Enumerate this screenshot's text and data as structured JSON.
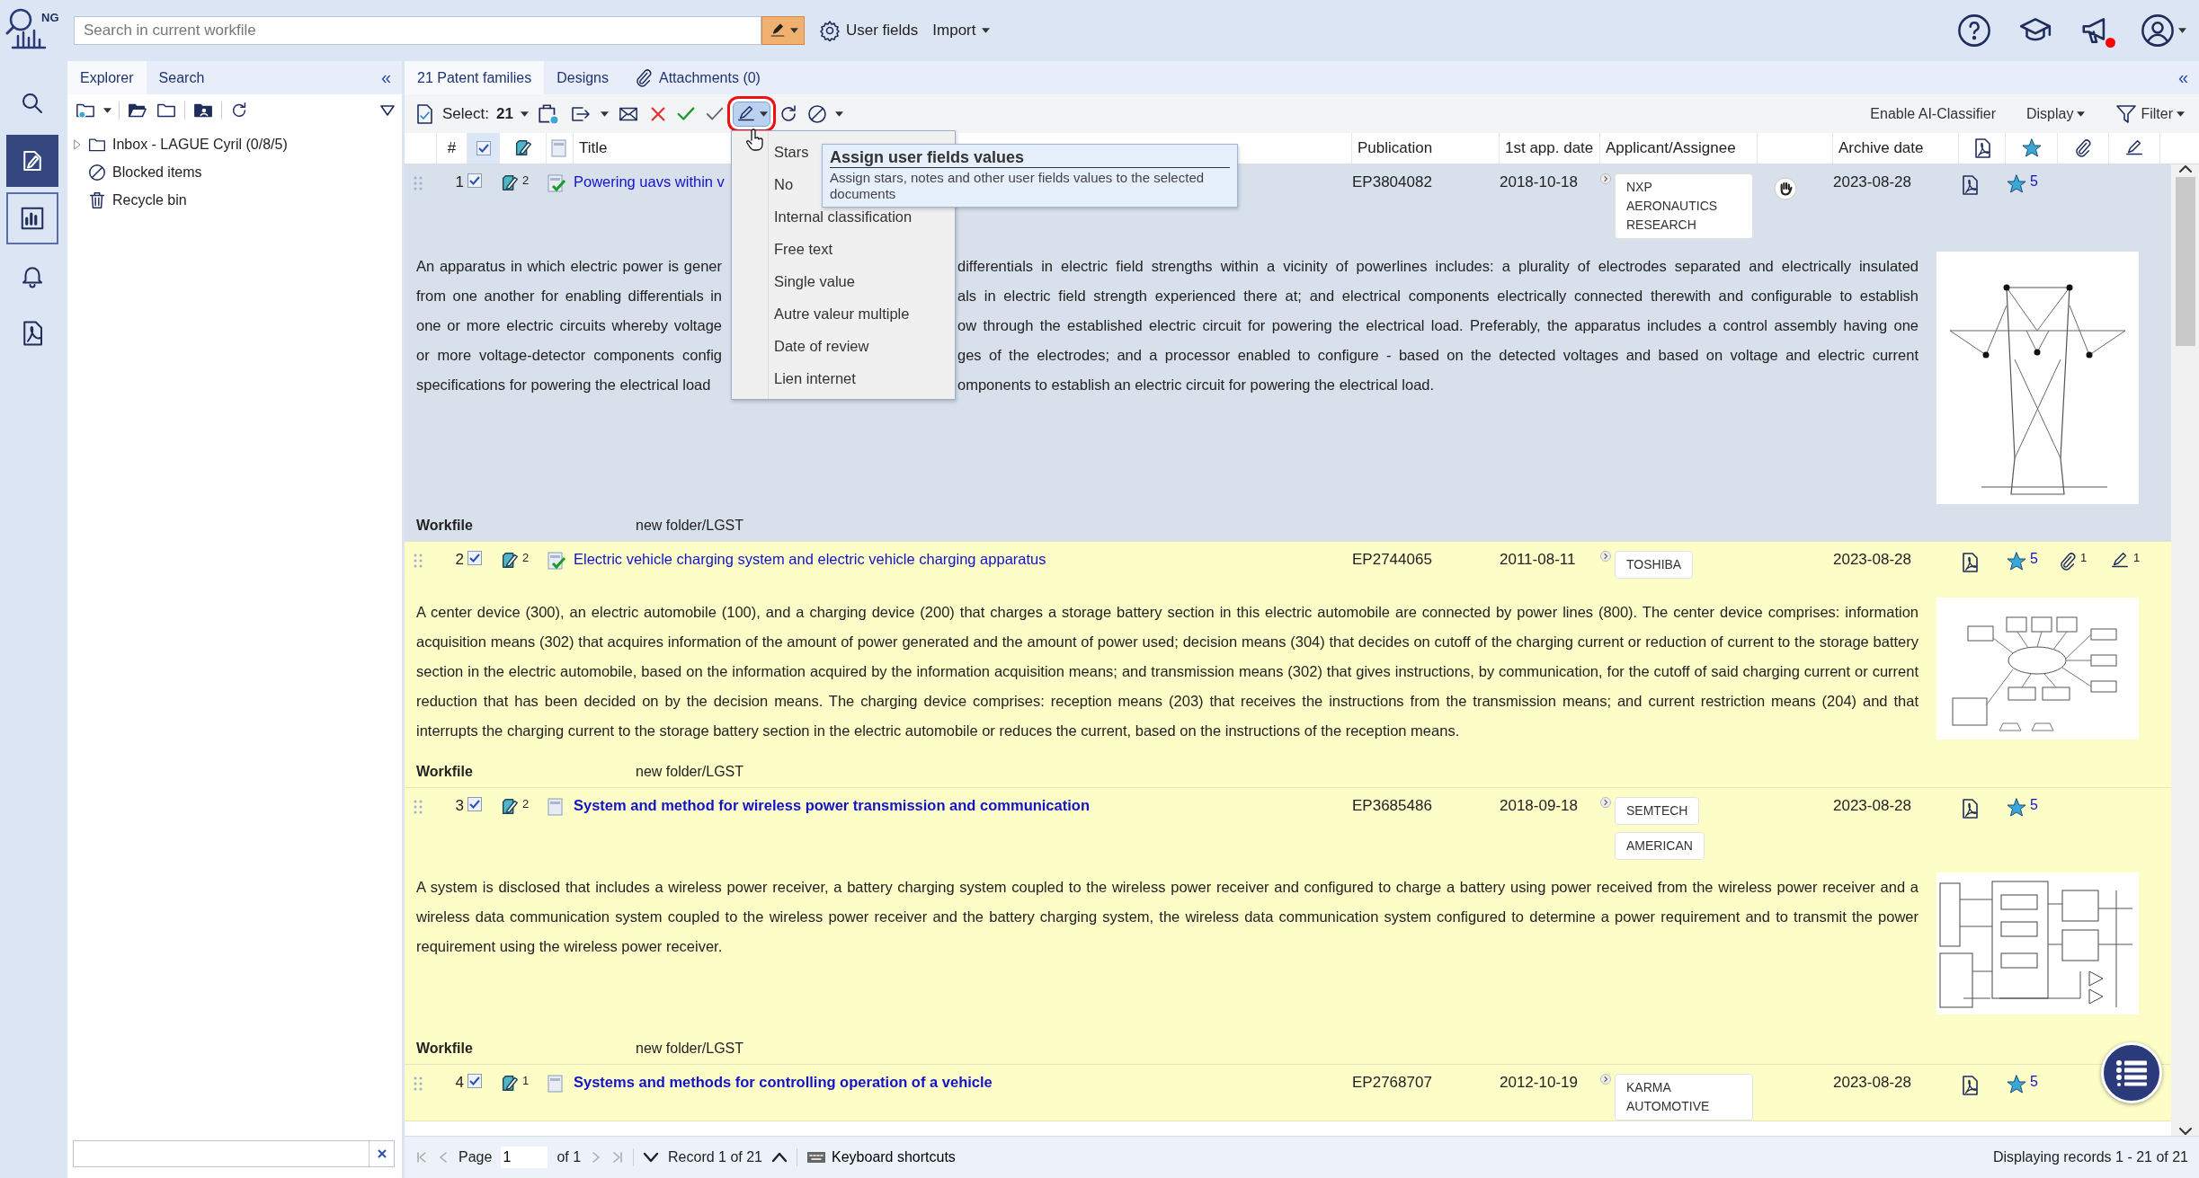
{
  "logo": {
    "text": "NG"
  },
  "search": {
    "placeholder": "Search in current workfile"
  },
  "top_actions": [
    {
      "label": "User fields",
      "kind": "gear"
    },
    {
      "label": "Import",
      "kind": "menu"
    }
  ],
  "notifications": {
    "unread": true
  },
  "rail": [
    {
      "selected": false,
      "focused": false
    },
    {
      "selected": true,
      "focused": false
    },
    {
      "selected": false,
      "focused": true
    },
    {
      "selected": false,
      "focused": false
    },
    {
      "selected": false,
      "focused": false
    }
  ],
  "explorer": {
    "tabs": [
      {
        "label": "Explorer",
        "selected": true
      },
      {
        "label": "Search",
        "selected": false
      }
    ],
    "collapse": "«",
    "tree": [
      {
        "label": "Inbox - LAGUE Cyril (0/8/5)",
        "kind": "folder",
        "expanded": false
      },
      {
        "label": "Blocked items",
        "kind": "blocked"
      },
      {
        "label": "Recycle bin",
        "kind": "trash"
      }
    ]
  },
  "main_tabs": [
    {
      "label": "21 Patent families",
      "selected": true
    },
    {
      "label": "Designs",
      "selected": false
    },
    {
      "label": "Attachments (0)",
      "selected": false,
      "kind": "attachments"
    }
  ],
  "main_collapse": "«",
  "toolbar": {
    "select_label": "Select:",
    "select_count": "21",
    "user_fields_pressed": true,
    "highlighted": true,
    "right": [
      {
        "label": "Enable AI-Classifier",
        "kind": "plain"
      },
      {
        "label": "Display",
        "kind": "menu"
      },
      {
        "label": "Filter",
        "kind": "filter"
      }
    ]
  },
  "menu": {
    "items": [
      "Stars",
      "No",
      "Internal classification",
      "Free text",
      "Single value",
      "Autre valeur multiple",
      "Date of review",
      "Lien internet"
    ]
  },
  "tooltip": {
    "title": "Assign user fields values",
    "text": "Assign stars, notes and other user fields values to the selected documents"
  },
  "table": {
    "number": "#",
    "select_all": true,
    "title": "Title",
    "publication": "Publication",
    "app_date": "1st app. date",
    "applicant": "Applicant/Assignee",
    "archive": "Archive date"
  },
  "rows": [
    {
      "number": "1",
      "checked": true,
      "notes": "2",
      "reviewed": true,
      "current": true,
      "unread": false,
      "title": "Powering uavs within v",
      "publication": "EP3804082",
      "app_date": "2018-10-18",
      "assignees": [
        "NXP AERONAUTICS RESEARCH"
      ],
      "blocked": true,
      "archive_date": "2023-08-28",
      "rating": "5",
      "abstract_lines": [
        {
          "left": "An apparatus in which electric power is gener",
          "right": "differentials in electric field strengths within a vicinity of powerlines includes: a plurality of electrodes separated and electrically insulated"
        },
        {
          "left": "from one another for enabling differentials in",
          "right": "als in electric field strength experienced there at; and electrical components electrically connected therewith and configurable to establish"
        },
        {
          "left": "one or more electric circuits whereby voltage",
          "right": "ow through the established electric circuit for powering the electrical load. Preferably, the apparatus includes a control assembly having one"
        },
        {
          "left": "or more voltage-detector components config",
          "right": "ges of the electrodes; and a processor enabled to configure - based on the detected voltages and based on voltage and electric current"
        },
        {
          "left": "specifications for powering the electrical load",
          "right": "omponents to establish an electric circuit for powering the electrical load."
        }
      ],
      "picture": {
        "kind": "picture"
      },
      "workfile_label": "Workfile",
      "workfile": "new folder/LGST"
    },
    {
      "number": "2",
      "checked": true,
      "notes": "2",
      "reviewed": true,
      "current": false,
      "unread": false,
      "title": "Electric vehicle charging system and electric vehicle charging apparatus",
      "publication": "EP2744065",
      "app_date": "2011-08-11",
      "assignees": [
        "TOSHIBA"
      ],
      "blocked": false,
      "archive_date": "2023-08-28",
      "rating": "5",
      "attachments": "1",
      "user_fields": "1",
      "abstract": "A center device (300), an electric automobile (100), and a charging device (200) that charges a storage battery section in this electric automobile are connected by power lines (800). The center device comprises: information acquisition means (302) that acquires information of the amount of power generated and the amount of power used; decision means (304) that decides on cutoff of the charging current or reduction of current to the storage battery section in the electric automobile, based on the information acquired by the information acquisition means; and transmission means (302) that gives instructions, by communication, for the cutoff of said charging current or current reduction that has been decided on by the decision means. The charging device comprises: reception means (203) that receives the instructions from the transmission means; and current restriction means (204) and that interrupts the charging current to the storage battery section in the electric automobile or reduces the current, based on the instructions of the reception means.",
      "picture": {
        "kind": "picture"
      },
      "workfile_label": "Workfile",
      "workfile": "new folder/LGST"
    },
    {
      "number": "3",
      "checked": true,
      "notes": "2",
      "reviewed": false,
      "current": false,
      "unread": true,
      "title": "System and method for wireless power transmission and communication",
      "publication": "EP3685486",
      "app_date": "2018-09-18",
      "assignees": [
        "SEMTECH",
        "AMERICAN"
      ],
      "blocked": false,
      "archive_date": "2023-08-28",
      "rating": "5",
      "abstract": "A system is disclosed that includes a wireless power receiver, a battery charging system coupled to the wireless power receiver and configured to charge a battery using power received from the wireless power receiver and a wireless data communication system coupled to the wireless power receiver and the battery charging system, the wireless data communication system configured to determine a power requirement and to transmit the power requirement using the wireless power receiver.",
      "picture": {
        "kind": "picture"
      },
      "workfile_label": "Workfile",
      "workfile": "new folder/LGST"
    },
    {
      "number": "4",
      "checked": true,
      "notes": "1",
      "reviewed": false,
      "current": false,
      "unread": true,
      "title": "Systems and methods for controlling operation of a vehicle",
      "publication": "EP2768707",
      "app_date": "2012-10-19",
      "assignees": [
        "KARMA AUTOMOTIVE"
      ],
      "blocked": false,
      "archive_date": "2023-08-28",
      "rating": "5"
    }
  ],
  "footer": {
    "page_label": "Page",
    "page": "1",
    "of": "of 1",
    "record": "Record 1 of 21",
    "shortcuts": "Keyboard shortcuts",
    "displaying": "Displaying records 1 - 21 of 21"
  }
}
